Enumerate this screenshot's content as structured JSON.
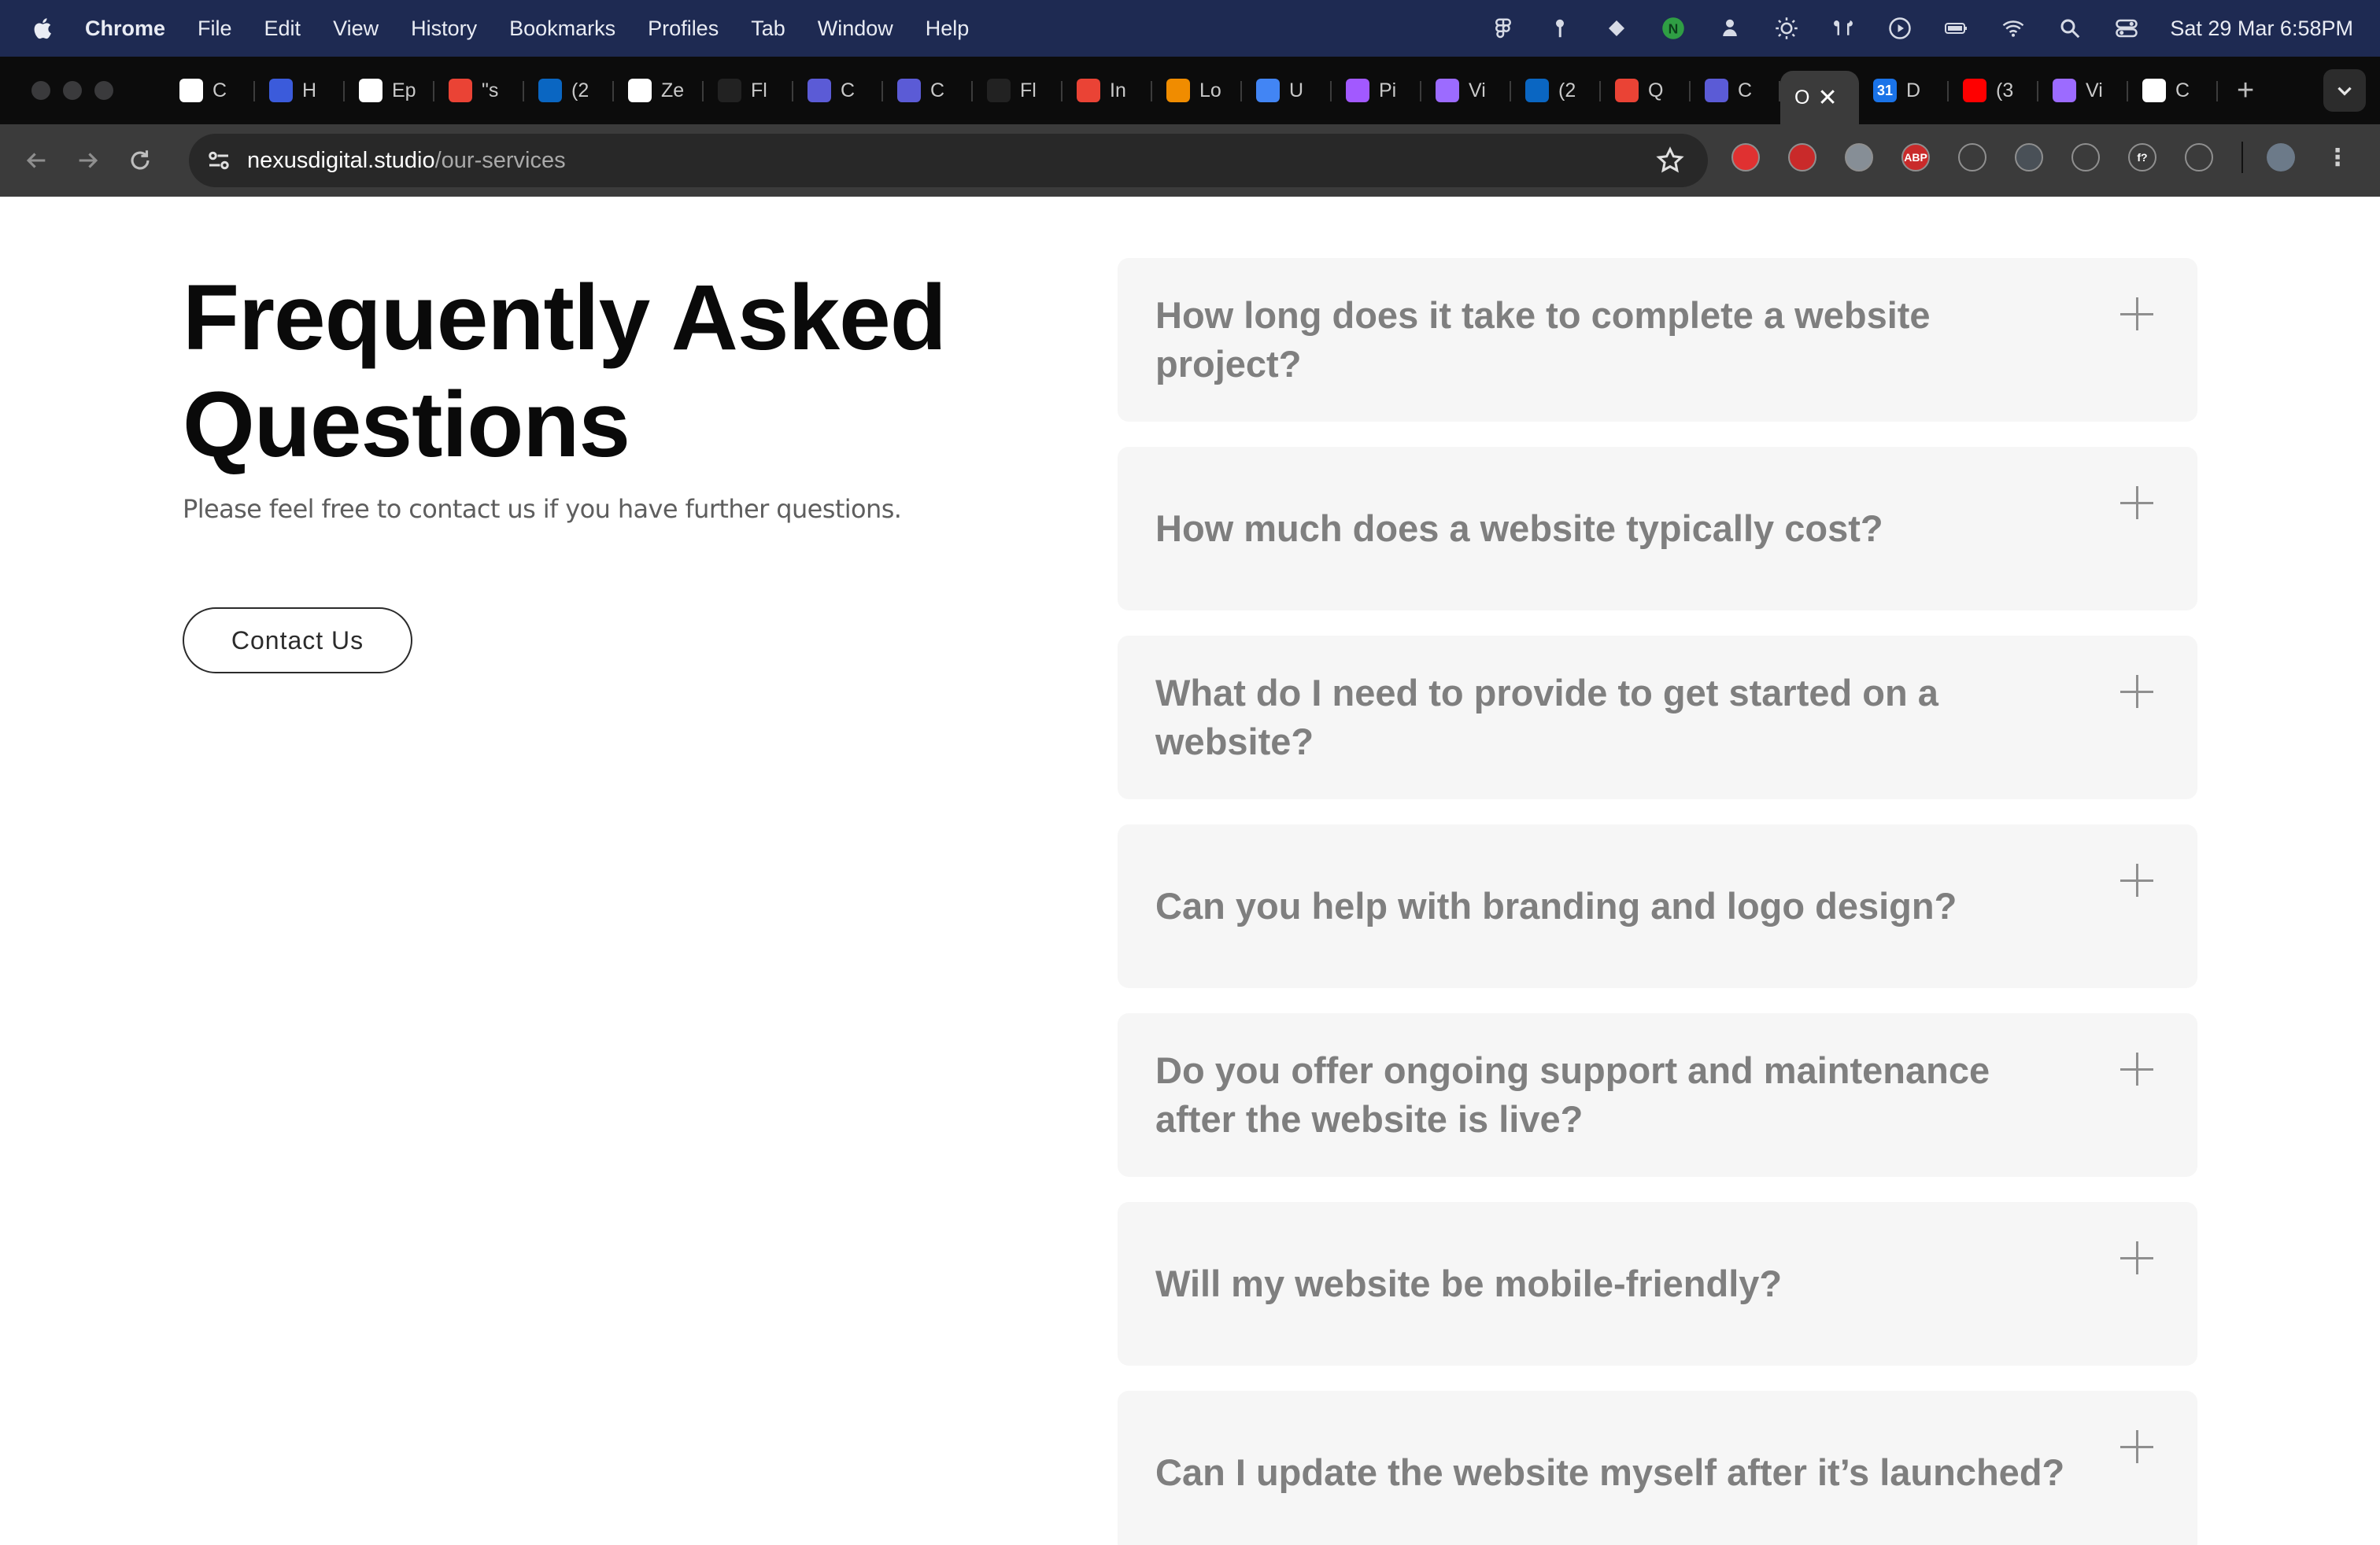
{
  "menubar": {
    "app_name": "Chrome",
    "menus": [
      "File",
      "Edit",
      "View",
      "History",
      "Bookmarks",
      "Profiles",
      "Tab",
      "Window",
      "Help"
    ],
    "clock": "Sat 29 Mar  6:58PM"
  },
  "tabs": [
    {
      "favicon": "openai-icon",
      "title": "C",
      "color": "#ffffff"
    },
    {
      "favicon": "k-icon",
      "title": "H",
      "color": "#3b5bdb"
    },
    {
      "favicon": "dice-icon",
      "title": "Ep",
      "color": "#ffffff"
    },
    {
      "favicon": "gmail-icon",
      "title": "\"s",
      "color": "#ea4335"
    },
    {
      "favicon": "linkedin-icon",
      "title": "(2",
      "color": "#0a66c2"
    },
    {
      "favicon": "zeplin-icon",
      "title": "Ze",
      "color": "#ffffff"
    },
    {
      "favicon": "fl-icon",
      "title": "Fl",
      "color": "#222222"
    },
    {
      "favicon": "crescent-icon",
      "title": "C",
      "color": "#5b5bd6"
    },
    {
      "favicon": "crescent-icon",
      "title": "C",
      "color": "#5b5bd6"
    },
    {
      "favicon": "fl-icon",
      "title": "Fl",
      "color": "#222222"
    },
    {
      "favicon": "gmail-icon",
      "title": "In",
      "color": "#ea4335"
    },
    {
      "favicon": "heart-icon",
      "title": "Lo",
      "color": "#f08c00"
    },
    {
      "favicon": "docs-icon",
      "title": "U",
      "color": "#4285f4"
    },
    {
      "favicon": "figma-icon",
      "title": "Pi",
      "color": "#a259ff"
    },
    {
      "favicon": "vite-icon",
      "title": "Vi",
      "color": "#9c6bff"
    },
    {
      "favicon": "linkedin-icon",
      "title": "(2",
      "color": "#0a66c2"
    },
    {
      "favicon": "gmail-icon",
      "title": "Q",
      "color": "#ea4335"
    },
    {
      "favicon": "crescent-icon",
      "title": "C",
      "color": "#5b5bd6"
    }
  ],
  "active_tab": {
    "title": "O",
    "close": "✕"
  },
  "tabs_after": [
    {
      "favicon": "calendar-icon",
      "title": "D",
      "color": "#1a73e8",
      "label": "31"
    },
    {
      "favicon": "youtube-icon",
      "title": "(3",
      "color": "#ff0000"
    },
    {
      "favicon": "vite-icon",
      "title": "Vi",
      "color": "#9c6bff"
    },
    {
      "favicon": "openai-icon",
      "title": "C",
      "color": "#ffffff"
    }
  ],
  "new_tab": "+",
  "address": {
    "domain": "nexusdigital.studio",
    "path": "/our-services"
  },
  "extensions": [
    {
      "name": "pokeball-extension-icon",
      "color": "#e03131",
      "label": ""
    },
    {
      "name": "hand-extension-icon",
      "color": "#c92a2a",
      "label": ""
    },
    {
      "name": "glasses-extension-icon",
      "color": "#868e96",
      "label": ""
    },
    {
      "name": "adblock-extension-icon",
      "color": "#c92a2a",
      "label": "ABP"
    },
    {
      "name": "eyedropper-extension-icon",
      "color": "#3b3b3b",
      "label": ""
    },
    {
      "name": "shield-extension-icon",
      "color": "#495057",
      "label": ""
    },
    {
      "name": "compass-extension-icon",
      "color": "#3b3b3b",
      "label": ""
    },
    {
      "name": "font-extension-icon",
      "color": "#3b3b3b",
      "label": "f?"
    },
    {
      "name": "puzzle-extension-icon",
      "color": "#3b3b3b",
      "label": ""
    }
  ],
  "faq": {
    "title": "Frequently Asked Questions",
    "subtitle": "Please feel free to contact us if you have further questions.",
    "contact_label": "Contact Us",
    "questions": [
      "How long does it take to complete a website project?",
      "How much does a website typically cost?",
      "What do I need to provide to get started on a website?",
      "Can you help with branding and logo design?",
      "Do you offer ongoing support and maintenance after the website is live?",
      "Will my website be mobile-friendly?",
      "Can I update the website myself after it’s launched?"
    ]
  }
}
